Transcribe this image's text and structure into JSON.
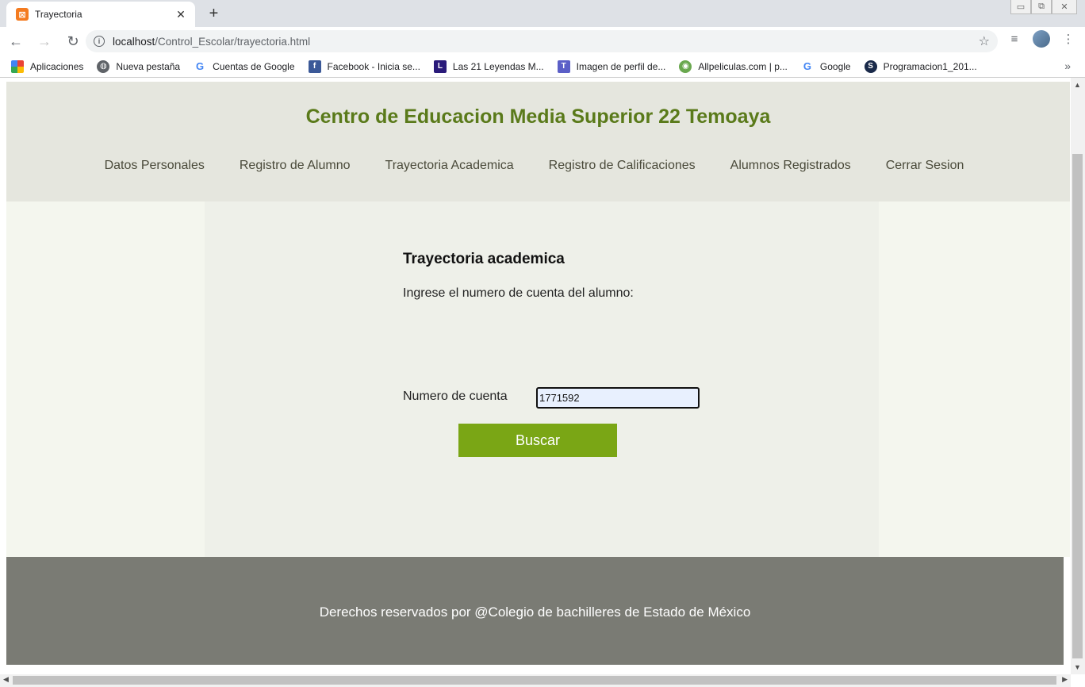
{
  "browser": {
    "tab_title": "Trayectoria",
    "url_host": "localhost",
    "url_path": "/Control_Escolar/trayectoria.html",
    "bookmarks": [
      {
        "label": "Aplicaciones",
        "icon": "apps-grid-icon"
      },
      {
        "label": "Nueva pestaña",
        "icon": "globe-icon"
      },
      {
        "label": "Cuentas de Google",
        "icon": "google-icon"
      },
      {
        "label": "Facebook - Inicia se...",
        "icon": "facebook-icon"
      },
      {
        "label": "Las 21 Leyendas M...",
        "icon": "l-icon"
      },
      {
        "label": "Imagen de perfil de...",
        "icon": "teams-icon"
      },
      {
        "label": "Allpeliculas.com | p...",
        "icon": "allpeliculas-icon"
      },
      {
        "label": "Google",
        "icon": "google-icon"
      },
      {
        "label": "Programacion1_201...",
        "icon": "s-icon"
      }
    ]
  },
  "site": {
    "title": "Centro de Educacion Media Superior 22 Temoaya",
    "nav": [
      {
        "label": "Datos Personales"
      },
      {
        "label": "Registro de Alumno"
      },
      {
        "label": "Trayectoria Academica"
      },
      {
        "label": "Registro de Calificaciones"
      },
      {
        "label": "Alumnos Registrados"
      },
      {
        "label": "Cerrar Sesion"
      }
    ]
  },
  "main": {
    "heading": "Trayectoria academica",
    "instructions": "Ingrese el numero de cuenta del alumno:",
    "account_label": "Numero de cuenta",
    "account_value": "1771592",
    "search_button": "Buscar"
  },
  "footer": {
    "text": "Derechos reservados por @Colegio de bachilleres de Estado de México"
  },
  "colors": {
    "title_green": "#5a7a1a",
    "button_green": "#7aa615",
    "header_bg": "#e5e6de",
    "footer_bg": "#7a7b74"
  }
}
